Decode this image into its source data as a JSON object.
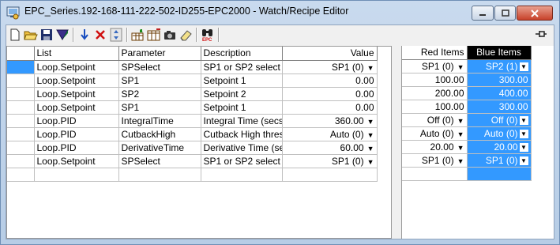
{
  "window": {
    "title": "EPC_Series.192-168-111-222-502-ID255-EPC2000 - Watch/Recipe Editor"
  },
  "toolbar": {
    "buttons": [
      "new-icon",
      "open-icon",
      "save-icon",
      "save-all-icon",
      "insert-icon",
      "delete-icon",
      "sort-icon",
      "chart-icon",
      "table-icon",
      "snapshot-icon",
      "eraser-icon",
      "find-icon",
      "epc-icon"
    ]
  },
  "left_table": {
    "columns": [
      "List",
      "Parameter",
      "Description",
      "Value"
    ],
    "rows": [
      {
        "list": "Loop.Setpoint",
        "parameter": "SPSelect",
        "description": "SP1 or SP2 select",
        "value": "SP1 (0)",
        "dropdown": true
      },
      {
        "list": "Loop.Setpoint",
        "parameter": "SP1",
        "description": "Setpoint 1",
        "value": "0.00",
        "dropdown": false
      },
      {
        "list": "Loop.Setpoint",
        "parameter": "SP2",
        "description": "Setpoint 2",
        "value": "0.00",
        "dropdown": false
      },
      {
        "list": "Loop.Setpoint",
        "parameter": "SP1",
        "description": "Setpoint 1",
        "value": "0.00",
        "dropdown": false
      },
      {
        "list": "Loop.PID",
        "parameter": "IntegralTime",
        "description": "Integral Time (secs)",
        "value": "360.00",
        "dropdown": true
      },
      {
        "list": "Loop.PID",
        "parameter": "CutbackHigh",
        "description": "Cutback High thresh",
        "value": "Auto (0)",
        "dropdown": true
      },
      {
        "list": "Loop.PID",
        "parameter": "DerivativeTime",
        "description": "Derivative Time (sec",
        "value": "60.00",
        "dropdown": true
      },
      {
        "list": "Loop.Setpoint",
        "parameter": "SPSelect",
        "description": "SP1 or SP2 select",
        "value": "SP1 (0)",
        "dropdown": true
      }
    ]
  },
  "right_table": {
    "columns": [
      "Red Items",
      "Blue Items"
    ],
    "rows": [
      {
        "red": "SP1 (0)",
        "red_dd": true,
        "blue": "SP2 (1)",
        "blue_dd": true
      },
      {
        "red": "100.00",
        "red_dd": false,
        "blue": "300.00",
        "blue_dd": false
      },
      {
        "red": "200.00",
        "red_dd": false,
        "blue": "400.00",
        "blue_dd": false
      },
      {
        "red": "100.00",
        "red_dd": false,
        "blue": "300.00",
        "blue_dd": false
      },
      {
        "red": "Off (0)",
        "red_dd": true,
        "blue": "Off (0)",
        "blue_dd": true
      },
      {
        "red": "Auto (0)",
        "red_dd": true,
        "blue": "Auto (0)",
        "blue_dd": true
      },
      {
        "red": "20.00",
        "red_dd": true,
        "blue": "20.00",
        "blue_dd": true
      },
      {
        "red": "SP1 (0)",
        "red_dd": true,
        "blue": "SP1 (0)",
        "blue_dd": true
      }
    ]
  },
  "colors": {
    "selection": "#3399ff",
    "blue_column": "#3399ff",
    "header_blue": "#000000"
  }
}
